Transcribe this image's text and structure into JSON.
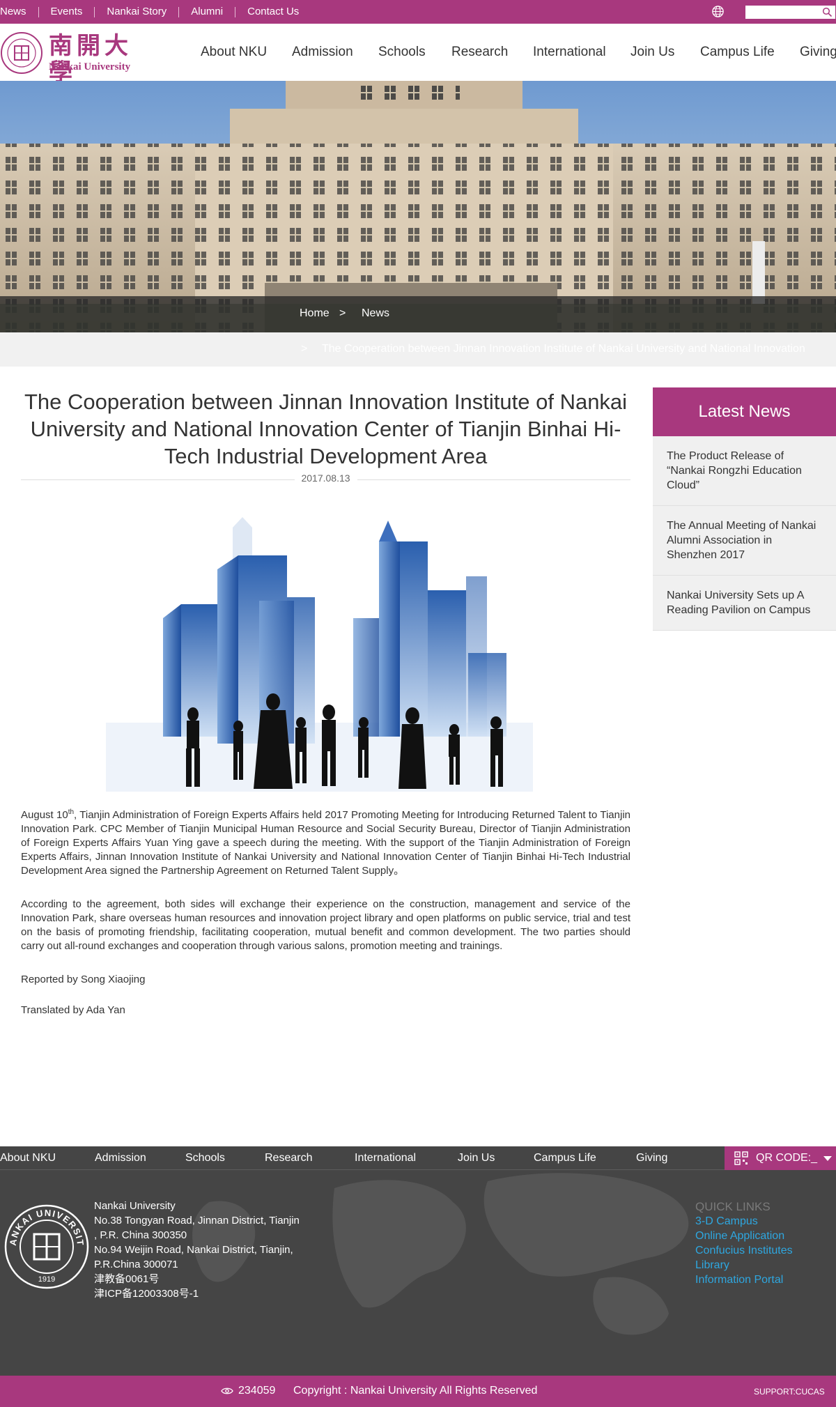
{
  "topbar": {
    "links": [
      "News",
      "Events",
      "Nankai Story",
      "Alumni",
      "Contact Us"
    ],
    "search_placeholder": ""
  },
  "header": {
    "logo_cn": "南開大學",
    "logo_en": "Nankai University",
    "nav": [
      "About NKU",
      "Admission",
      "Schools",
      "Research",
      "International",
      "Join Us",
      "Campus Life",
      "Giving"
    ]
  },
  "breadcrumb": {
    "home": "Home",
    "separator": ">",
    "section": "News",
    "current_separator": ">",
    "current": "The Cooperation between Jinnan Innovation Institute of Nankai University and National Innovation"
  },
  "article": {
    "title": "The Cooperation between Jinnan Innovation Institute of Nankai University and National Innovation Center of Tianjin Binhai Hi-Tech Industrial Development Area",
    "date": "2017.08.13",
    "p1_lead": "August 10",
    "p1_sup": "th",
    "p1_rest": ", Tianjin Administration of Foreign Experts Affairs held 2017 Promoting Meeting for Introducing Returned Talent to Tianjin Innovation Park. CPC Member of Tianjin Municipal Human Resource and Social Security Bureau, Director of Tianjin Administration of Foreign Experts Affairs Yuan Ying gave a speech during the meeting. With the support of the Tianjin Administration of Foreign Experts Affairs, Jinnan Innovation Institute of Nankai University and National Innovation Center of Tianjin Binhai Hi-Tech Industrial Development Area signed the Partnership Agreement on Returned Talent Supply。",
    "p2": "According to the agreement, both sides will exchange their experience on the construction, management and service of the Innovation Park, share overseas human resources and innovation project library and open platforms on public service, trial and test on the basis of promoting friendship, facilitating cooperation, mutual benefit and common development. The two parties should carry out all-round exchanges and cooperation through various salons, promotion meeting and trainings.",
    "reporter": "Reported by Song Xiaojing",
    "translator": "Translated by Ada Yan"
  },
  "sidebar": {
    "heading": "Latest News",
    "items": [
      "The Product Release of “Nankai Rongzhi Education Cloud”",
      "The Annual Meeting of Nankai Alumni Association in Shenzhen 2017",
      "Nankai University Sets up A Reading Pavilion on Campus"
    ]
  },
  "footer": {
    "nav": [
      "About NKU",
      "Admission",
      "Schools",
      "Research",
      "International",
      "Join Us",
      "Campus Life",
      "Giving"
    ],
    "qr_label": "QR CODE:_",
    "address": [
      "Nankai University",
      "No.38 Tongyan Road, Jinnan District, Tianjin",
      ", P.R. China 300350",
      "No.94 Weijin Road,  Nankai District, Tianjin,",
      "P.R.China  300071",
      "津教备0061号",
      "津ICP备12003308号-1"
    ],
    "seal_text": "NANKAI UNIVERSITY",
    "seal_year": "1919",
    "quick_heading": "QUICK LINKS",
    "quick_links": [
      "3-D Campus",
      "Online Application",
      "Confucius Institutes",
      "Library",
      "Information Portal"
    ],
    "views": "234059",
    "copyright": "Copyright : Nankai University All Rights Reserved",
    "support": "SUPPORT:CUCAS"
  },
  "colors": {
    "brand": "#a8387e",
    "footer_bg": "#454545",
    "link_blue": "#2ea7e0"
  }
}
